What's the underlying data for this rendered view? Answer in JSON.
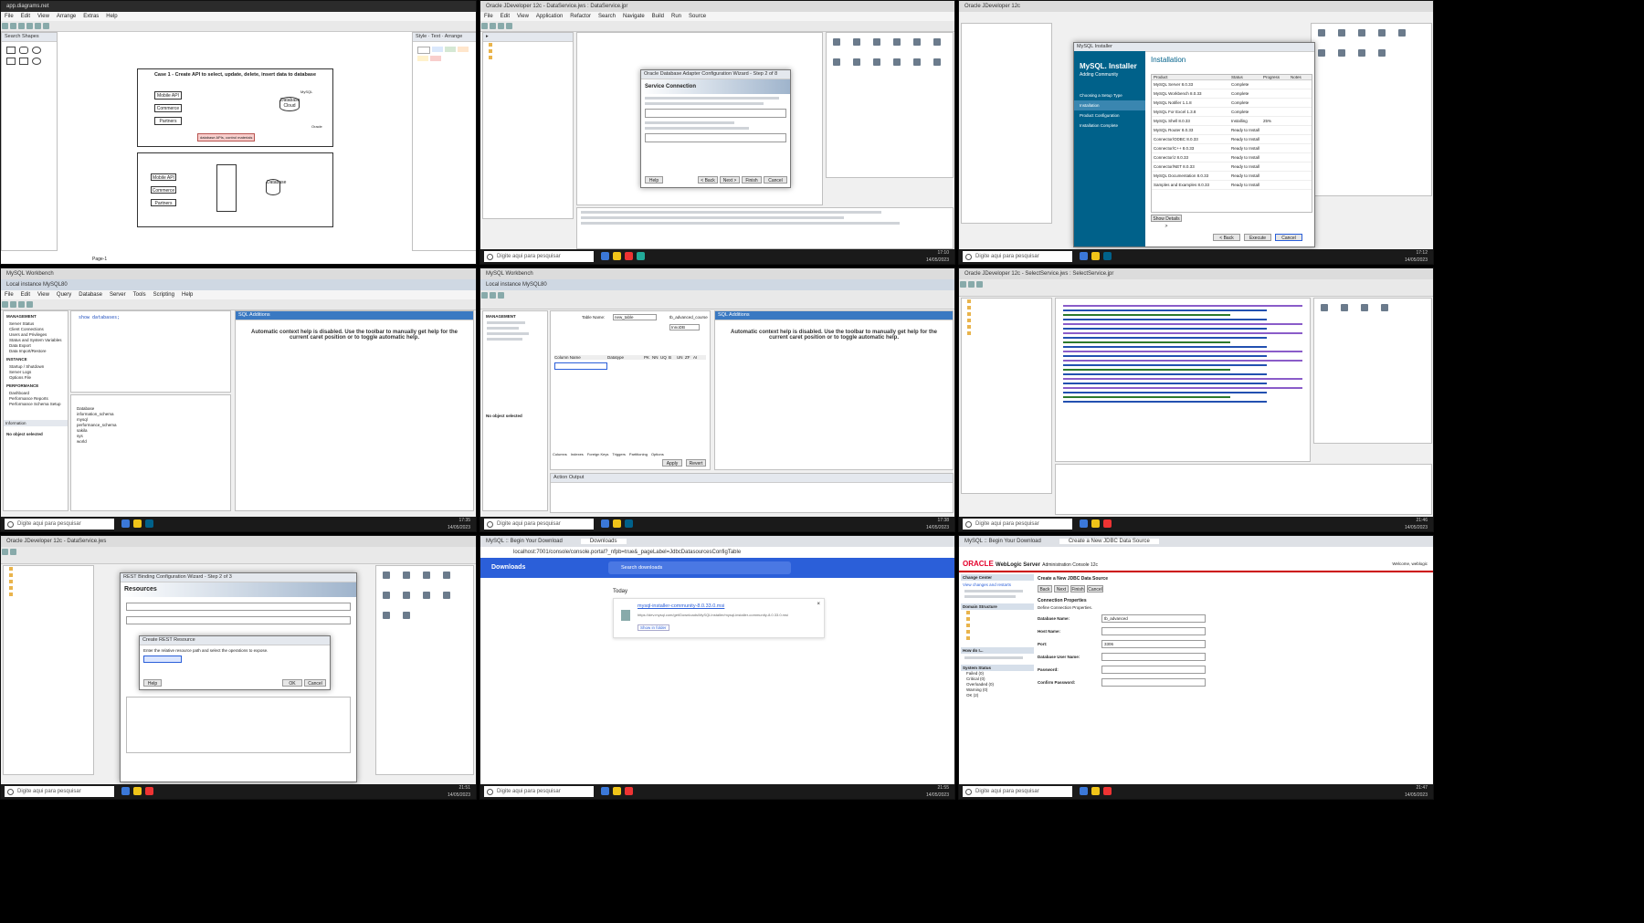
{
  "taskbar": {
    "search_placeholder": "Digite aqui para pesquisar",
    "clocks": [
      "17:06",
      "17:10",
      "17:12",
      "17:35",
      "17:38",
      "21:46",
      "21:51",
      "21:55",
      "21:47"
    ],
    "dates": [
      "14/05/2023",
      "14/05/2023",
      "14/05/2023",
      "14/05/2023",
      "14/05/2023",
      "14/05/2023",
      "14/05/2023",
      "14/05/2023",
      "14/05/2023"
    ]
  },
  "t1": {
    "title": "Case 1 - Create API to select, update, delete, insert data to database",
    "url": "app.diagrams.net",
    "menu": [
      "File",
      "Edit",
      "View",
      "Arrange",
      "Extras",
      "Help"
    ],
    "tabs": [
      "Style",
      "Text",
      "Arrange"
    ],
    "search": "Search Shapes",
    "page_tab": "Page-1",
    "boxes": [
      "Mobile API",
      "Commerce",
      "Partners",
      "Database Cloud"
    ],
    "highlight": "database APIs, control materials",
    "bottom_boxes": [
      "Mobile API",
      "Commerce",
      "Partners",
      "Database"
    ],
    "labels": [
      "MySQL",
      "Oracle"
    ]
  },
  "t2": {
    "title": "Oracle JDeveloper 12c - DataService.jws : DataService.jpr",
    "menu": [
      "File",
      "Edit",
      "View",
      "Application",
      "Refactor",
      "Search",
      "Navigate",
      "Build",
      "Run",
      "Source",
      "Team",
      "Tools",
      "Window",
      "Help"
    ],
    "dialog_title": "Oracle Database Adapter Configuration Wizard - Step 2 of 8",
    "dialog_heading": "Service Connection",
    "dialog_buttons": [
      "Help",
      "< Back",
      "Next >",
      "Finish",
      "Cancel"
    ]
  },
  "t3": {
    "title": "MySQL Installer",
    "heading": "MySQL. Installer",
    "sub": "Adding Community",
    "section": "Installation",
    "steps": [
      "Choosing a Setup Type",
      "Installation",
      "Product Configuration",
      "Installation Complete"
    ],
    "products": [
      {
        "name": "MySQL Server 8.0.33",
        "status": "Complete"
      },
      {
        "name": "MySQL Workbench 8.0.33",
        "status": "Complete"
      },
      {
        "name": "MySQL Notifier 1.1.8",
        "status": "Complete"
      },
      {
        "name": "MySQL For Excel 1.3.8",
        "status": "Complete"
      },
      {
        "name": "MySQL Shell 8.0.33",
        "status": "Installing"
      },
      {
        "name": "MySQL Router 8.0.33",
        "status": "Ready to Install"
      },
      {
        "name": "Connector/ODBC 8.0.33",
        "status": "Ready to Install"
      },
      {
        "name": "Connector/C++ 8.0.33",
        "status": "Ready to Install"
      },
      {
        "name": "Connector/J 8.0.33",
        "status": "Ready to Install"
      },
      {
        "name": "Connector/NET 8.0.33",
        "status": "Ready to Install"
      },
      {
        "name": "MySQL Documentation 8.0.33",
        "status": "Ready to Install"
      },
      {
        "name": "Samples and Examples 8.0.33",
        "status": "Ready to Install"
      }
    ],
    "columns": [
      "Product",
      "Status",
      "Progress",
      "Notes"
    ],
    "progress": "25%",
    "buttons": [
      "Show Details >",
      "< Back",
      "Execute",
      "Cancel"
    ]
  },
  "t4": {
    "title": "MySQL Workbench",
    "tab": "Local instance MySQL80",
    "menu": [
      "File",
      "Edit",
      "View",
      "Query",
      "Database",
      "Server",
      "Tools",
      "Scripting",
      "Help"
    ],
    "sections": [
      "MANAGEMENT",
      "INSTANCE",
      "PERFORMANCE"
    ],
    "mgmt_items": [
      "Server Status",
      "Client Connections",
      "Users and Privileges",
      "Status and System Variables",
      "Data Export",
      "Data Import/Restore"
    ],
    "instance_items": [
      "Startup / Shutdown",
      "Server Logs",
      "Options File"
    ],
    "perf_items": [
      "Dashboard",
      "Performance Reports",
      "Performance Schema Setup"
    ],
    "query": "show databases;",
    "help": "Automatic context help is disabled. Use the toolbar to manually get help for the current caret position or to toggle automatic help.",
    "result": [
      "Database",
      "information_schema",
      "mysql",
      "performance_schema",
      "sakila",
      "sys",
      "world"
    ],
    "no_object": "No object selected",
    "info": "Information"
  },
  "t5": {
    "title": "MySQL Workbench",
    "tab": "Local instance MySQL80",
    "table_name_label": "Table Name:",
    "table_name": "new_table",
    "schema": "tb_advanced_course",
    "engine": "InnoDB",
    "help": "Automatic context help is disabled. Use the toolbar to manually get help for the current caret position or to toggle automatic help.",
    "subtabs": [
      "Columns",
      "Indexes",
      "Foreign Keys",
      "Triggers",
      "Partitioning",
      "Options"
    ],
    "buttons": [
      "Apply",
      "Revert"
    ],
    "output": "Action Output",
    "no_object": "No object selected",
    "col_heads": [
      "Column Name",
      "Datatype",
      "PK",
      "NN",
      "UQ",
      "B",
      "UN",
      "ZF",
      "AI",
      "G"
    ]
  },
  "t6": {
    "title": "Oracle JDeveloper 12c - SelectService.jws : SelectService.jpr"
  },
  "t7": {
    "title": "Oracle JDeveloper 12c - DataService.jws",
    "wizard": "REST Binding Configuration Wizard - Step 2 of 3",
    "heading": "Resources",
    "dialog": "Create REST Resource",
    "dialog_text": "Enter the relative resource path and select the operations to expose.",
    "buttons": [
      "Help",
      "OK",
      "Cancel"
    ]
  },
  "t8": {
    "tab1": "MySQL :: Begin Your Download",
    "tab2": "Downloads",
    "url": "localhost:7001/console/console.portal?_nfpb=true&_pageLabel=JdbcDatasourcesConfigTable",
    "heading": "Downloads",
    "search": "Search downloads",
    "today": "Today",
    "file": "mysql-installer-community-8.0.33.0.msi",
    "link": "https://dev.mysql.com/get/Downloads/MySQLInstaller/mysql-installer-community-8.0.33.0.msi",
    "action": "Show in folder"
  },
  "t9": {
    "tab1": "MySQL :: Begin Your Download",
    "tab2": "Create a New JDBC Data Source",
    "brand": "ORACLE",
    "product": "WebLogic Server",
    "sub": "Administration Console 12c",
    "welcome": "Welcome, weblogic",
    "crumb": "Create a New JDBC Data Source",
    "buttons": [
      "Back",
      "Next",
      "Finish",
      "Cancel"
    ],
    "section": "Connection Properties",
    "desc": "Define Connection Properties.",
    "fields": [
      {
        "label": "Database Name:",
        "value": "tb_advanced"
      },
      {
        "label": "Host Name:",
        "value": ""
      },
      {
        "label": "Port:",
        "value": "3306"
      },
      {
        "label": "Database User Name:",
        "value": ""
      },
      {
        "label": "Password:",
        "value": ""
      },
      {
        "label": "Confirm Password:",
        "value": ""
      }
    ],
    "left_sections": [
      "Change Center",
      "Domain Structure",
      "How do I...",
      "System Status"
    ],
    "view_changes": "View changes and restarts",
    "health": [
      "Failed (0)",
      "Critical (0)",
      "Overloaded (0)",
      "Warning (0)",
      "OK (2)"
    ]
  },
  "colors": {
    "accent": "#2b5fd9",
    "oracle_red": "#e4002b",
    "mysql_blue": "#00618a",
    "ok_green": "#4aa34a"
  }
}
